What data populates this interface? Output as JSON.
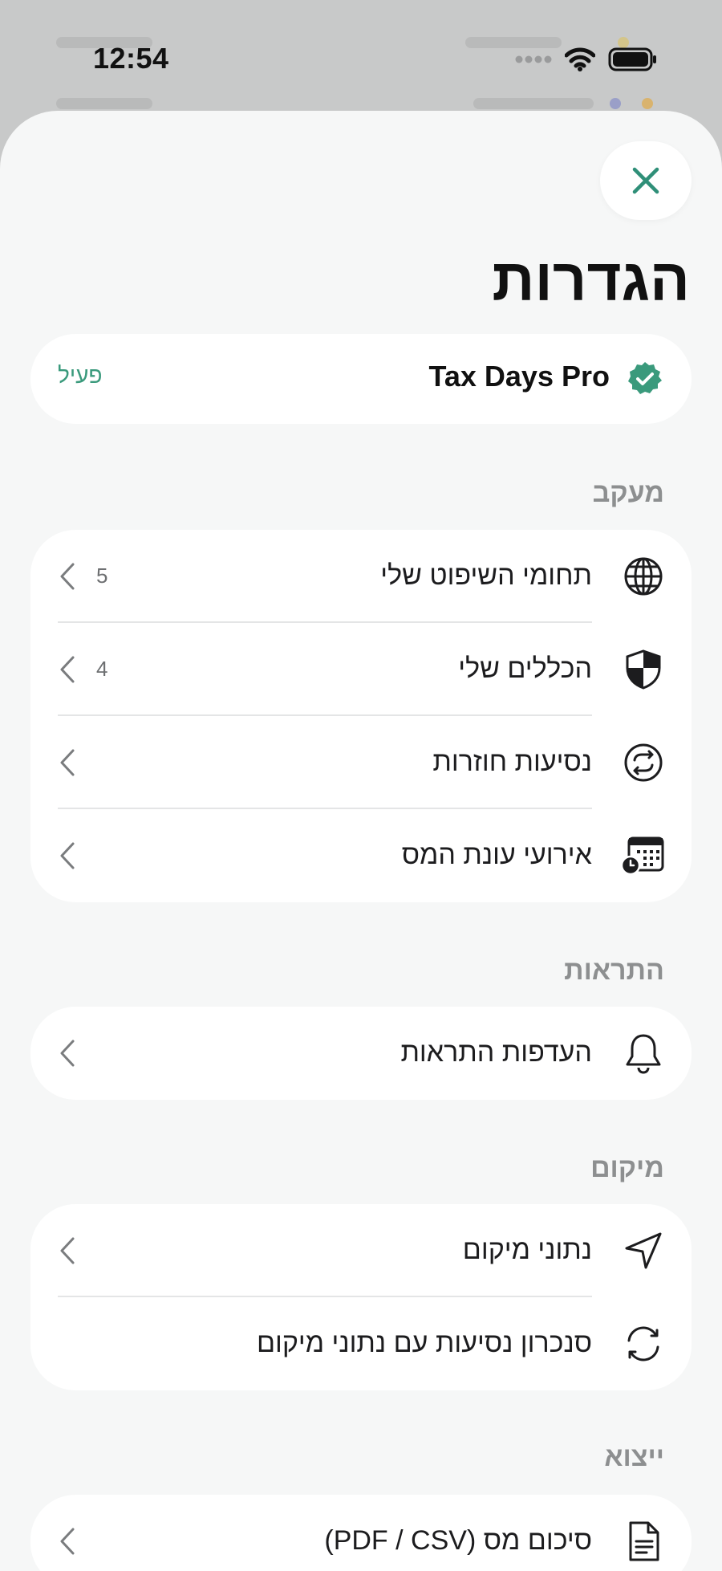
{
  "status_bar": {
    "time": "12:54"
  },
  "settings": {
    "title": "הגדרות",
    "close_icon": "close-icon",
    "pro": {
      "name": "Tax Days Pro",
      "status": "פעיל",
      "badge_icon": "verified-badge-icon"
    },
    "sections": [
      {
        "header": "מעקב",
        "rows": [
          {
            "label": "תחומי השיפוט שלי",
            "count": "5",
            "icon": "globe-icon"
          },
          {
            "label": "הכללים שלי",
            "count": "4",
            "icon": "shield-icon"
          },
          {
            "label": "נסיעות חוזרות",
            "icon": "repeat-icon"
          },
          {
            "label": "אירועי עונת המס",
            "icon": "calendar-clock-icon"
          }
        ]
      },
      {
        "header": "התראות",
        "rows": [
          {
            "label": "העדפות התראות",
            "icon": "bell-icon"
          }
        ]
      },
      {
        "header": "מיקום",
        "rows": [
          {
            "label": "נתוני מיקום",
            "icon": "location-arrow-icon"
          },
          {
            "label": "סנכרון נסיעות עם נתוני מיקום",
            "icon": "sync-icon"
          }
        ]
      },
      {
        "header": "ייצוא",
        "rows": [
          {
            "label": "סיכום מס (PDF / CSV)",
            "icon": "document-icon"
          }
        ]
      }
    ]
  },
  "colors": {
    "accent": "#2f8f78",
    "badge": "#3a9a7c",
    "sheet_bg": "#f6f7f7",
    "text_secondary": "#8d8f90"
  }
}
